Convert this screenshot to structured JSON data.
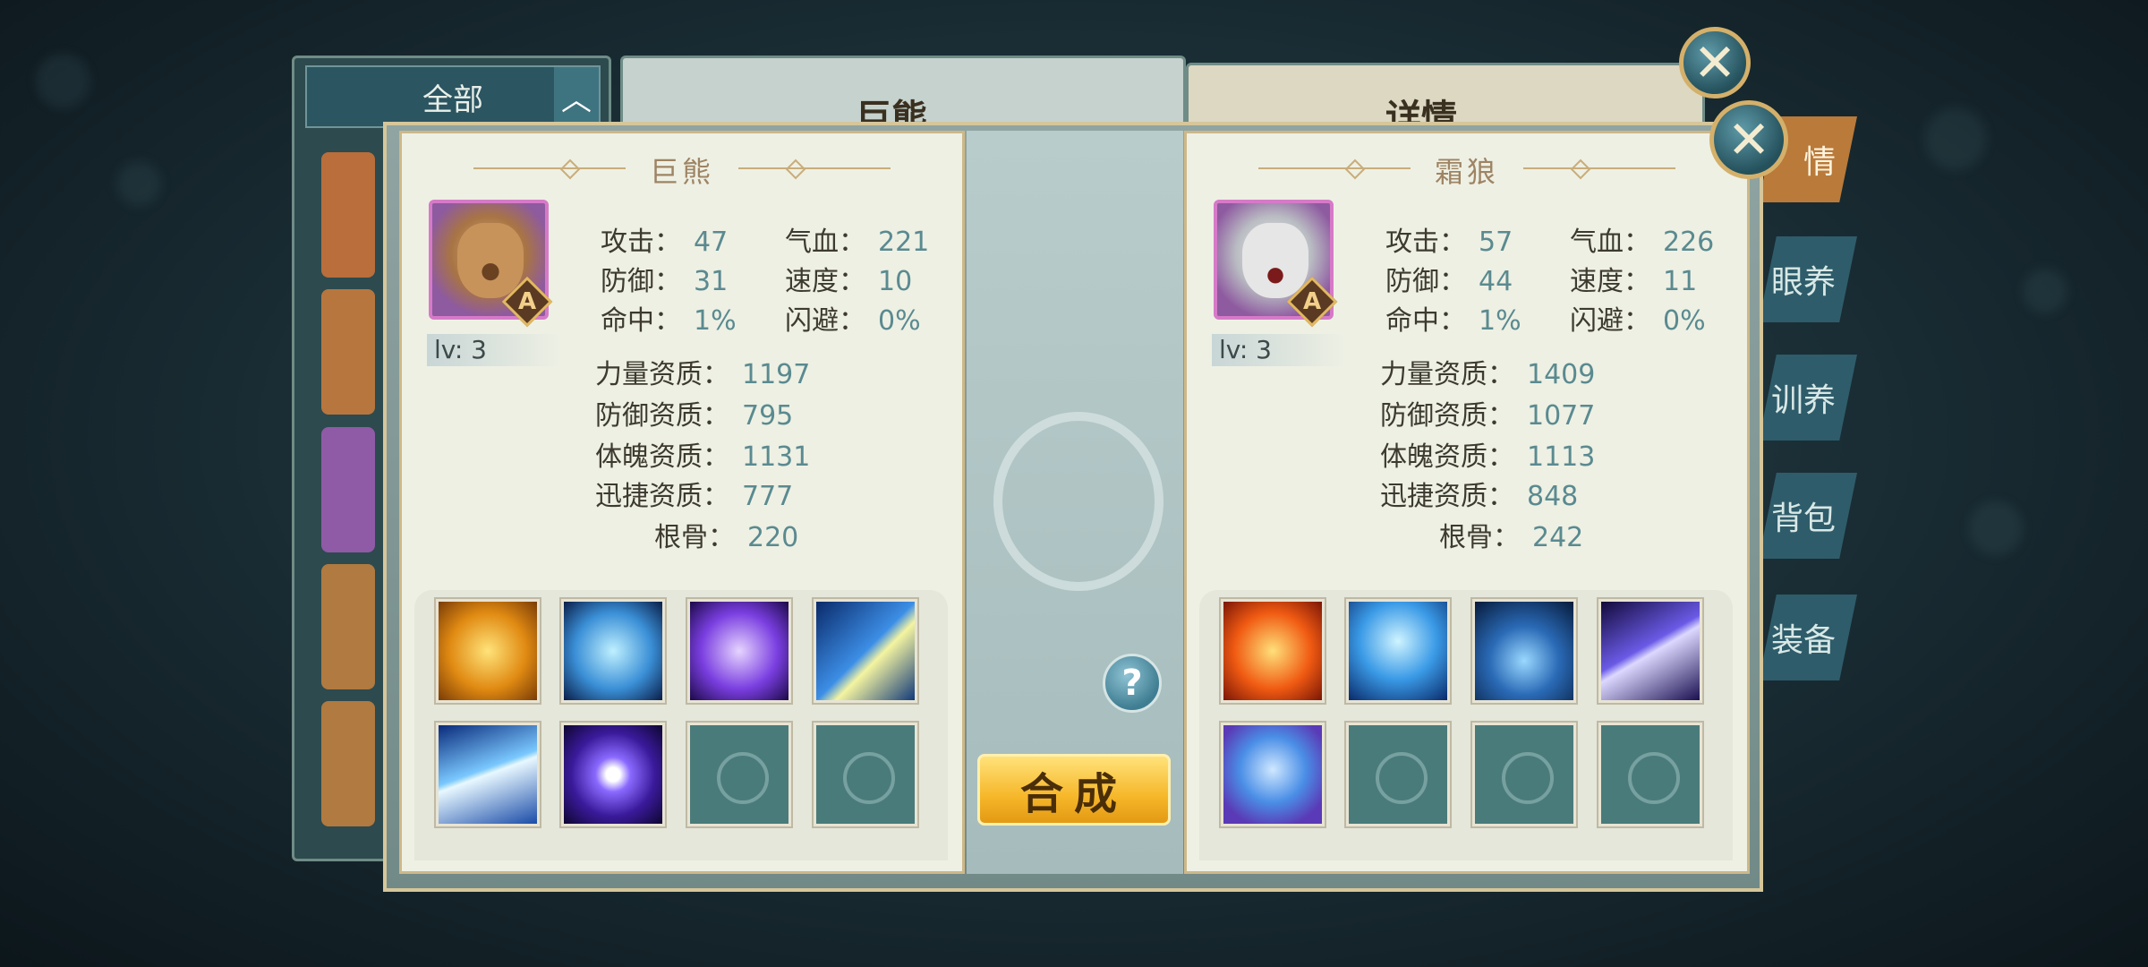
{
  "background": {
    "filter_label": "全部",
    "center_title": "巨熊",
    "detail_title": "详情",
    "side_tabs": [
      "情",
      "眼养",
      "训养",
      "背包",
      "装备"
    ]
  },
  "dialog": {
    "compose_label": "合成",
    "help_label": "?",
    "left": {
      "name": "巨熊",
      "grade": "A",
      "level": "lv: 3",
      "attack_label": "攻击：",
      "attack": "47",
      "hp_label": "气血：",
      "hp": "221",
      "defense_label": "防御：",
      "defense": "31",
      "speed_label": "速度：",
      "speed": "10",
      "hit_label": "命中：",
      "hit": "1%",
      "dodge_label": "闪避：",
      "dodge": "0%",
      "str_apt_label": "力量资质：",
      "str_apt": "1197",
      "def_apt_label": "防御资质：",
      "def_apt": "795",
      "con_apt_label": "体魄资质：",
      "con_apt": "1131",
      "agi_apt_label": "迅捷资质：",
      "agi_apt": "777",
      "root_label": "根骨：",
      "root": "220",
      "skills": [
        "lion-roar-skill-icon",
        "water-heart-skill-icon",
        "purple-vortex-skill-icon",
        "lightning-shield-skill-icon",
        "speed-streak-skill-icon",
        "purple-orb-skill-icon",
        "empty",
        "empty"
      ]
    },
    "right": {
      "name": "霜狼",
      "grade": "A",
      "level": "lv: 3",
      "attack_label": "攻击：",
      "attack": "57",
      "hp_label": "气血：",
      "hp": "226",
      "defense_label": "防御：",
      "defense": "44",
      "speed_label": "速度：",
      "speed": "11",
      "hit_label": "命中：",
      "hit": "1%",
      "dodge_label": "闪避：",
      "dodge": "0%",
      "str_apt_label": "力量资质：",
      "str_apt": "1409",
      "def_apt_label": "防御资质：",
      "def_apt": "1077",
      "con_apt_label": "体魄资质：",
      "con_apt": "1113",
      "agi_apt_label": "迅捷资质：",
      "agi_apt": "848",
      "root_label": "根骨：",
      "root": "242",
      "skills": [
        "fire-beast-skill-icon",
        "ice-wall-skill-icon",
        "ice-spikes-skill-icon",
        "claw-slash-skill-icon",
        "blue-shield-skill-icon",
        "empty",
        "empty",
        "empty"
      ]
    }
  },
  "colors": {
    "compose_button": "#f6b72a",
    "stat_value": "#5a8a90",
    "portrait_border": "#d67ac8"
  }
}
